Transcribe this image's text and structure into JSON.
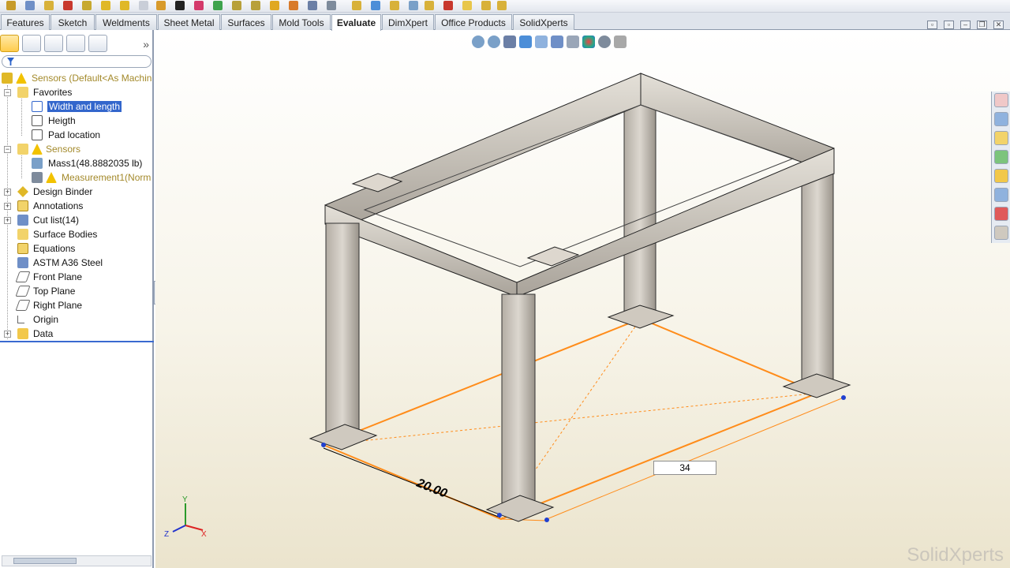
{
  "command_manager": {
    "tabs": [
      {
        "label": "Features",
        "active": false
      },
      {
        "label": "Sketch",
        "active": false
      },
      {
        "label": "Weldments",
        "active": false
      },
      {
        "label": "Sheet Metal",
        "active": false
      },
      {
        "label": "Surfaces",
        "active": false
      },
      {
        "label": "Mold Tools",
        "active": false
      },
      {
        "label": "Evaluate",
        "active": true
      },
      {
        "label": "DimXpert",
        "active": false
      },
      {
        "label": "Office Products",
        "active": false
      },
      {
        "label": "SolidXperts",
        "active": false
      }
    ]
  },
  "feature_tree": {
    "root": "Sensors  (Default<As Machin",
    "favorites": {
      "label": "Favorites",
      "items": [
        "Width and length",
        "Heigth",
        "Pad location"
      ]
    },
    "sensors": {
      "label": "Sensors",
      "items": [
        "Mass1(48.8882035 lb)",
        "Measurement1(Norm"
      ]
    },
    "nodes": [
      "Design Binder",
      "Annotations",
      "Cut list(14)",
      "Surface Bodies",
      "Equations",
      "ASTM A36 Steel",
      "Front Plane",
      "Top Plane",
      "Right Plane",
      "Origin",
      "Data"
    ]
  },
  "viewport": {
    "dimension_label": "20.00",
    "edit_box_value": "34",
    "triad": {
      "x": "X",
      "y": "Y",
      "z": "Z"
    },
    "watermark": "SolidXperts"
  },
  "colors": {
    "accent": "#ff8c1a",
    "selection": "#3366cc",
    "frame": "#c8c2b8"
  }
}
